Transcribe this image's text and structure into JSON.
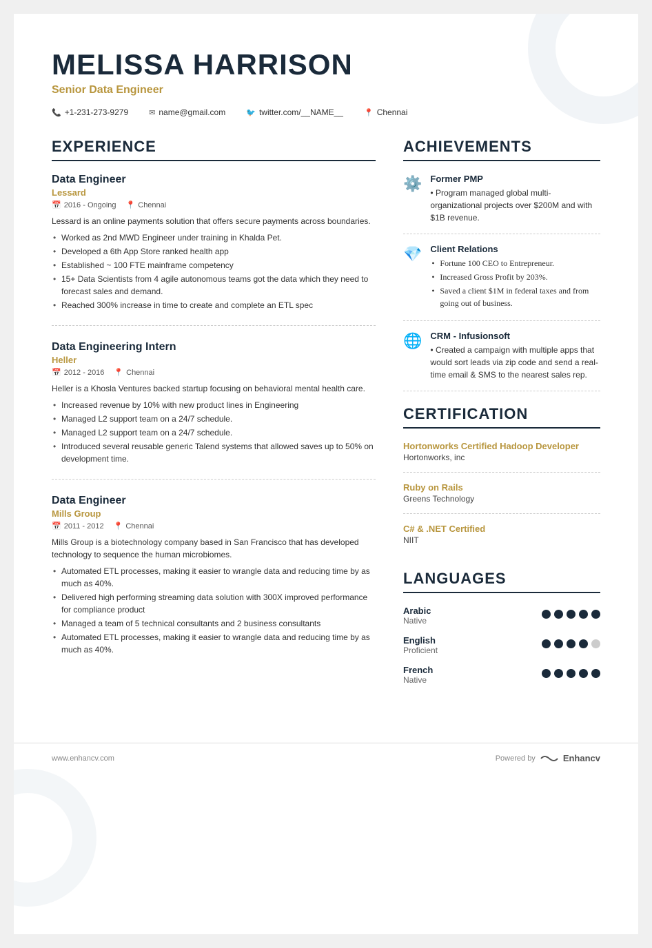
{
  "header": {
    "name": "MELISSA HARRISON",
    "title": "Senior Data Engineer",
    "phone": "+1-231-273-9279",
    "email": "name@gmail.com",
    "twitter": "twitter.com/__NAME__",
    "location": "Chennai"
  },
  "experience_section": "EXPERIENCE",
  "experience": [
    {
      "job_title": "Data Engineer",
      "company": "Lessard",
      "period": "2016 - Ongoing",
      "location": "Chennai",
      "description": "Lessard is an online payments solution that offers secure payments across boundaries.",
      "bullets": [
        "Worked as 2nd MWD Engineer under training in Khalda Pet.",
        "Developed a 6th App Store ranked health app",
        "Established ~ 100 FTE mainframe competency",
        "15+ Data Scientists from 4 agile autonomous teams got the data which they need to forecast sales and demand.",
        "Reached 300% increase in time to create and complete an ETL spec"
      ]
    },
    {
      "job_title": "Data Engineering Intern",
      "company": "Heller",
      "period": "2012 - 2016",
      "location": "Chennai",
      "description": "Heller is a Khosla Ventures backed startup focusing on behavioral mental health care.",
      "bullets": [
        "Increased revenue by 10% with new product lines in Engineering",
        "Managed L2 support team on a 24/7 schedule.",
        "Managed L2 support team on a 24/7 schedule.",
        "Introduced several reusable generic Talend systems that allowed saves up to 50% on development time."
      ]
    },
    {
      "job_title": "Data Engineer",
      "company": "Mills Group",
      "period": "2011 - 2012",
      "location": "Chennai",
      "description": "Mills Group is a biotechnology company based in San Francisco that has developed technology to sequence the human microbiomes.",
      "bullets": [
        "Automated ETL processes, making it easier to wrangle data and reducing time by as much as 40%.",
        "Delivered high performing streaming data solution with 300X improved performance for compliance product",
        "Managed a team of 5 technical consultants and 2 business consultants",
        "Automated ETL processes, making it easier to wrangle data and reducing time by as much as 40%."
      ]
    }
  ],
  "achievements_section": "ACHIEVEMENTS",
  "achievements": [
    {
      "icon": "⚙️",
      "title": "Former PMP",
      "text": "• Program managed global multi-organizational projects over $200M and with $1B revenue."
    },
    {
      "icon": "💎",
      "title": "Client Relations",
      "bullets": [
        "Fortune 100 CEO to Entrepreneur.",
        "Increased Gross Profit by 203%.",
        "Saved a client $1M in federal taxes and from going out of business."
      ]
    },
    {
      "icon": "🌐",
      "title": "CRM - Infusionsoft",
      "text": "• Created a campaign with multiple apps that would sort leads via zip code and send a real-time email & SMS to the nearest sales rep."
    }
  ],
  "certification_section": "CERTIFICATION",
  "certifications": [
    {
      "name": "Hortonworks Certified Hadoop Developer",
      "issuer": "Hortonworks, inc"
    },
    {
      "name": "Ruby on Rails",
      "issuer": "Greens Technology"
    },
    {
      "name": "C# & .NET Certified",
      "issuer": "NIIT"
    }
  ],
  "languages_section": "LANGUAGES",
  "languages": [
    {
      "name": "Arabic",
      "level": "Native",
      "dots": [
        1,
        1,
        1,
        1,
        1
      ]
    },
    {
      "name": "English",
      "level": "Proficient",
      "dots": [
        1,
        1,
        1,
        1,
        0
      ]
    },
    {
      "name": "French",
      "level": "Native",
      "dots": [
        1,
        1,
        1,
        1,
        1
      ]
    }
  ],
  "footer": {
    "url": "www.enhancv.com",
    "powered_by": "Powered by",
    "brand": "Enhancv"
  }
}
